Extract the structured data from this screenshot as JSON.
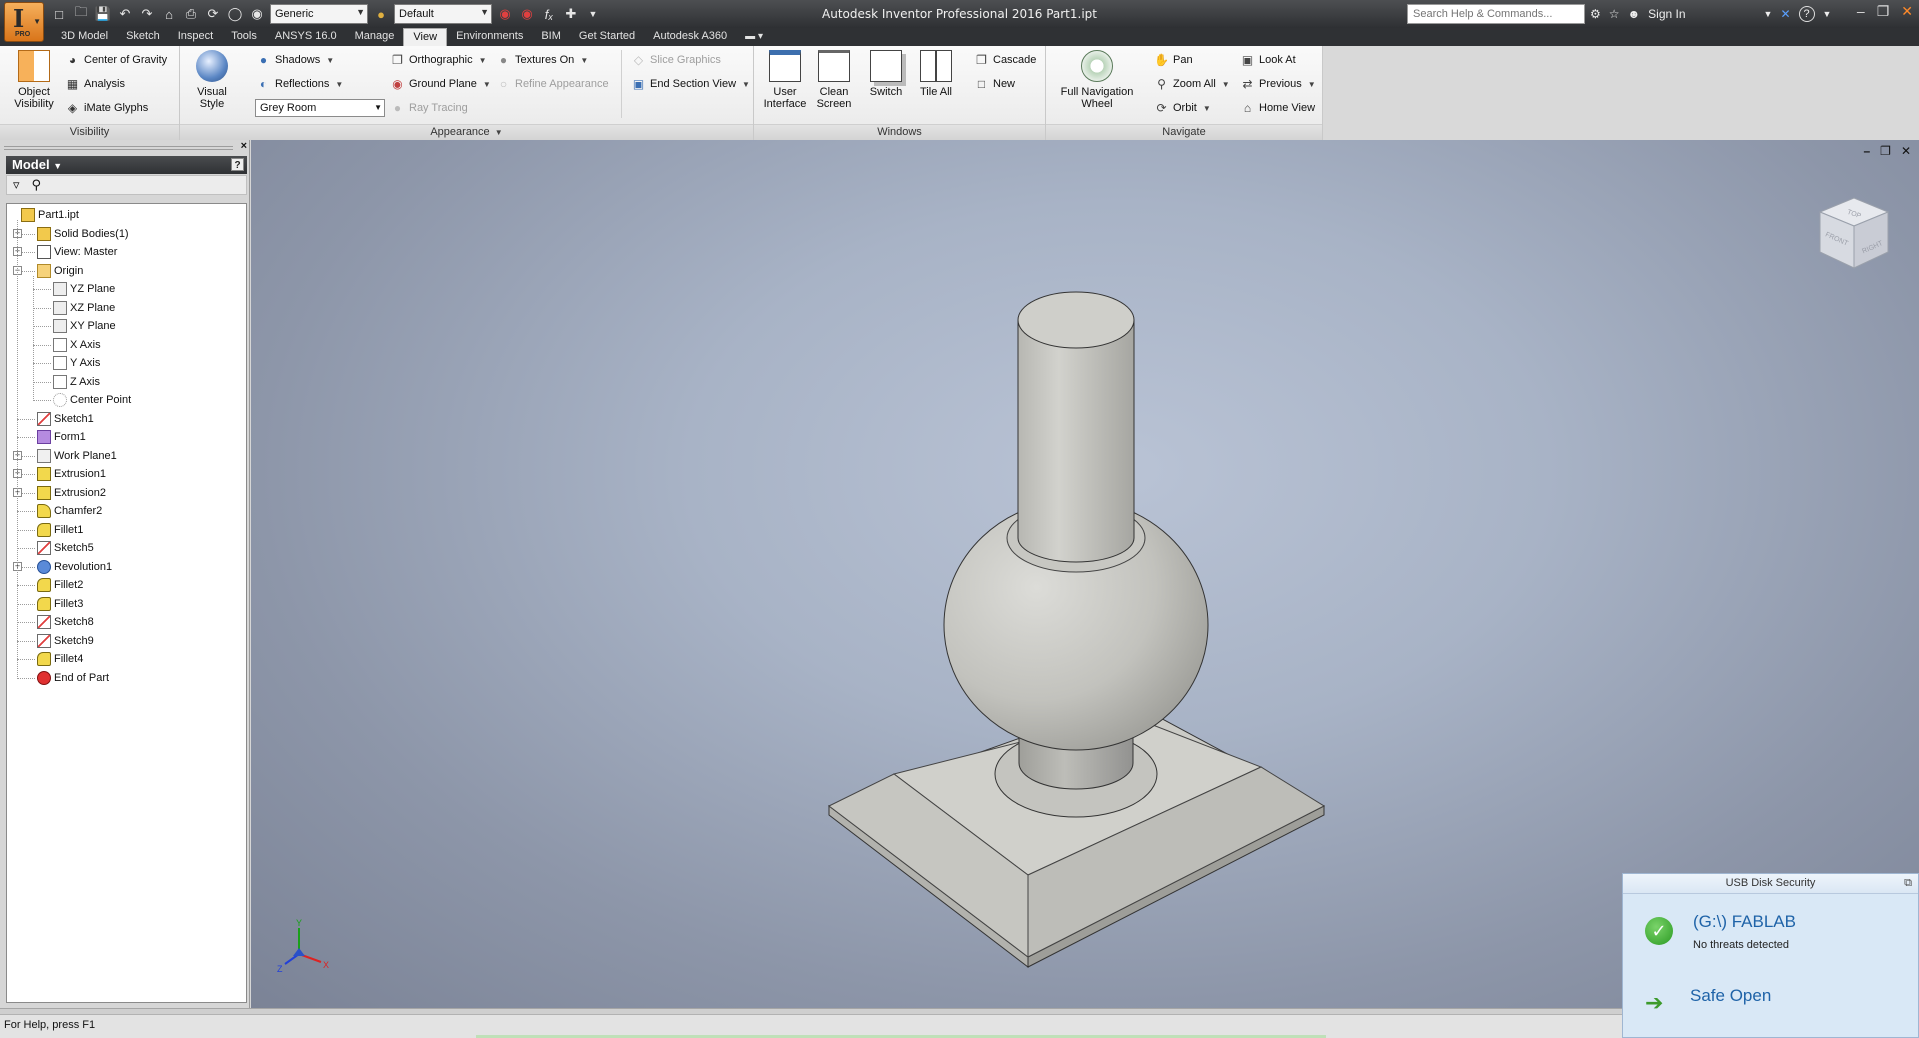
{
  "titlebar": {
    "title": "Autodesk Inventor Professional 2016    Part1.ipt",
    "app_letter": "I",
    "app_edition": "PRO",
    "material": "Generic",
    "appearance": "Default",
    "search_placeholder": "Search Help & Commands...",
    "sign_in": "Sign In"
  },
  "ribbon_tabs": [
    "3D Model",
    "Sketch",
    "Inspect",
    "Tools",
    "ANSYS 16.0",
    "Manage",
    "View",
    "Environments",
    "BIM",
    "Get Started",
    "Autodesk A360"
  ],
  "active_tab": "View",
  "ribbon": {
    "visibility": {
      "label": "Visibility",
      "object_visibility": "Object\nVisibility",
      "center_of_gravity": "Center of Gravity",
      "analysis": "Analysis",
      "imate_glyphs": "iMate Glyphs"
    },
    "appearance": {
      "label": "Appearance",
      "visual_style": "Visual Style",
      "shadows": "Shadows",
      "reflections": "Reflections",
      "environment": "Grey Room",
      "orthographic": "Orthographic",
      "ground_plane": "Ground Plane",
      "ray_tracing": "Ray Tracing",
      "textures_on": "Textures On",
      "refine_appearance": "Refine Appearance",
      "slice_graphics": "Slice Graphics",
      "end_section_view": "End Section View"
    },
    "windows": {
      "label": "Windows",
      "user_interface": "User\nInterface",
      "clean_screen": "Clean\nScreen",
      "switch": "Switch",
      "tile_all": "Tile All",
      "cascade": "Cascade",
      "new": "New"
    },
    "navigate": {
      "label": "Navigate",
      "full_nav_wheel": "Full Navigation\nWheel",
      "pan": "Pan",
      "zoom_all": "Zoom All",
      "orbit": "Orbit",
      "look_at": "Look At",
      "previous": "Previous",
      "home_view": "Home View"
    }
  },
  "browser": {
    "title": "Model",
    "tree": [
      {
        "label": "Part1.ipt",
        "icon": "part-icon",
        "indent": 0,
        "expander": ""
      },
      {
        "label": "Solid Bodies(1)",
        "icon": "solid-bodies-icon",
        "indent": 1,
        "expander": "+"
      },
      {
        "label": "View: Master",
        "icon": "view-icon",
        "indent": 1,
        "expander": "+"
      },
      {
        "label": "Origin",
        "icon": "folder-icon",
        "indent": 1,
        "expander": "-"
      },
      {
        "label": "YZ Plane",
        "icon": "plane-icon",
        "indent": 2,
        "expander": ""
      },
      {
        "label": "XZ Plane",
        "icon": "plane-icon",
        "indent": 2,
        "expander": ""
      },
      {
        "label": "XY Plane",
        "icon": "plane-icon",
        "indent": 2,
        "expander": ""
      },
      {
        "label": "X Axis",
        "icon": "axis-icon",
        "indent": 2,
        "expander": ""
      },
      {
        "label": "Y Axis",
        "icon": "axis-icon",
        "indent": 2,
        "expander": ""
      },
      {
        "label": "Z Axis",
        "icon": "axis-icon",
        "indent": 2,
        "expander": ""
      },
      {
        "label": "Center Point",
        "icon": "center-point-icon",
        "indent": 2,
        "expander": ""
      },
      {
        "label": "Sketch1",
        "icon": "sketch-icon",
        "indent": 1,
        "expander": ""
      },
      {
        "label": "Form1",
        "icon": "form-icon",
        "indent": 1,
        "expander": ""
      },
      {
        "label": "Work Plane1",
        "icon": "work-plane-icon",
        "indent": 1,
        "expander": "+"
      },
      {
        "label": "Extrusion1",
        "icon": "extrusion-icon",
        "indent": 1,
        "expander": "+"
      },
      {
        "label": "Extrusion2",
        "icon": "extrusion-icon",
        "indent": 1,
        "expander": "+"
      },
      {
        "label": "Chamfer2",
        "icon": "chamfer-icon",
        "indent": 1,
        "expander": ""
      },
      {
        "label": "Fillet1",
        "icon": "fillet-icon",
        "indent": 1,
        "expander": ""
      },
      {
        "label": "Sketch5",
        "icon": "sketch-icon",
        "indent": 1,
        "expander": ""
      },
      {
        "label": "Revolution1",
        "icon": "revolution-icon",
        "indent": 1,
        "expander": "+"
      },
      {
        "label": "Fillet2",
        "icon": "fillet-icon",
        "indent": 1,
        "expander": ""
      },
      {
        "label": "Fillet3",
        "icon": "fillet-icon",
        "indent": 1,
        "expander": ""
      },
      {
        "label": "Sketch8",
        "icon": "sketch-icon",
        "indent": 1,
        "expander": ""
      },
      {
        "label": "Sketch9",
        "icon": "sketch-icon",
        "indent": 1,
        "expander": ""
      },
      {
        "label": "Fillet4",
        "icon": "fillet-icon",
        "indent": 1,
        "expander": ""
      },
      {
        "label": "End of Part",
        "icon": "end-of-part-icon",
        "indent": 1,
        "expander": ""
      }
    ]
  },
  "viewcube": {
    "top": "TOP",
    "front": "FRONT",
    "right": "RIGHT"
  },
  "triad": {
    "x": "X",
    "y": "Y",
    "z": "Z"
  },
  "statusbar": {
    "help": "For Help, press F1"
  },
  "usb_popup": {
    "title": "USB Disk Security",
    "drive": "(G:\\) FABLAB",
    "status": "No threats detected",
    "action": "Safe Open"
  },
  "colors": {
    "accent_orange": "#d9751a",
    "model_gray": "#c9c9c4",
    "usb_blue": "#1f63a8",
    "ok_green": "#2a9a22"
  }
}
